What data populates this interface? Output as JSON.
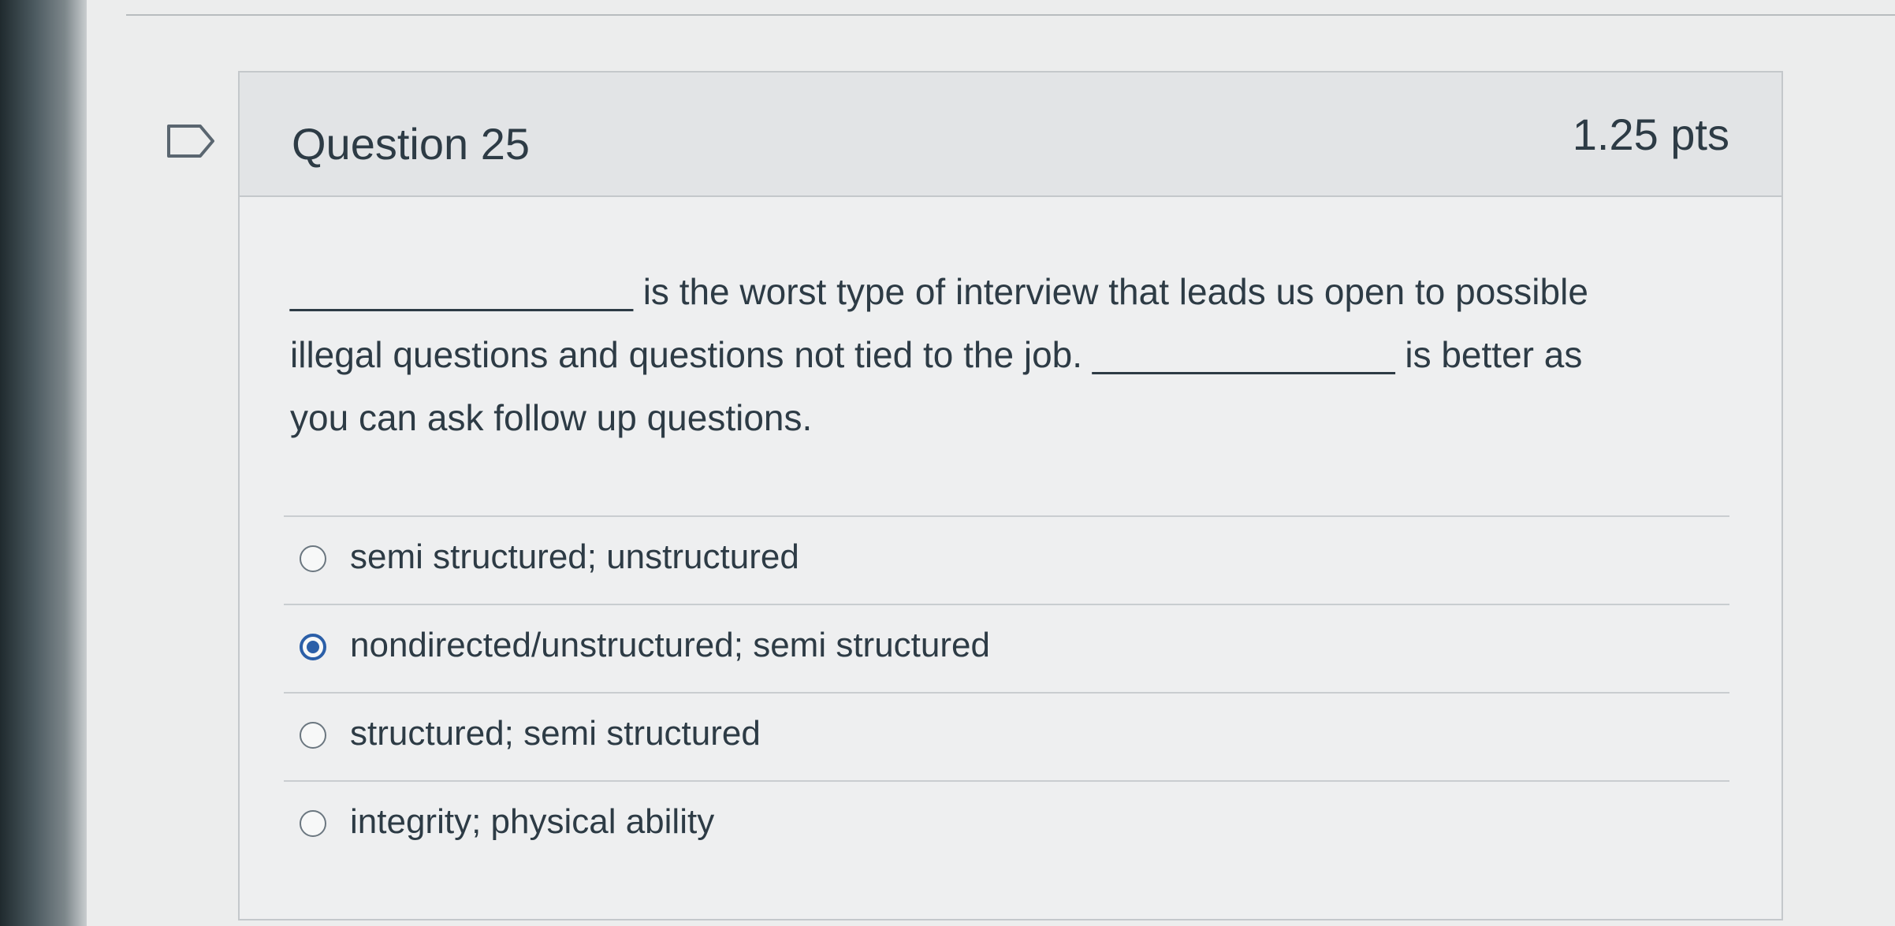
{
  "question": {
    "title": "Question 25",
    "points": "1.25 pts",
    "text_line1": "_________________ is the worst type of interview that leads us open to possible",
    "text_line2": "illegal questions and questions not tied to the job. _______________ is better as",
    "text_line3": "you can ask follow up questions."
  },
  "answers": [
    {
      "label": "semi structured; unstructured",
      "selected": false
    },
    {
      "label": "nondirected/unstructured; semi structured",
      "selected": true
    },
    {
      "label": "structured; semi structured",
      "selected": false
    },
    {
      "label": "integrity; physical ability",
      "selected": false
    }
  ],
  "icons": {
    "flag": "flag-question-icon"
  },
  "colors": {
    "selected_radio": "#2b5fa8",
    "text": "#2d3b45",
    "header_bg": "#e2e4e6"
  }
}
